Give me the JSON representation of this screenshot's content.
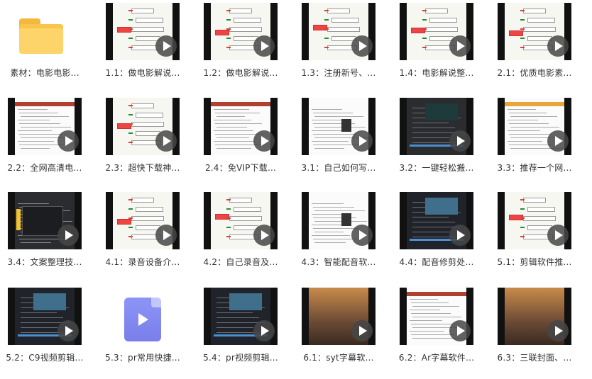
{
  "items": [
    {
      "label": "素材：电影电影...",
      "type": "folder"
    },
    {
      "label": "1.1：做电影解说...",
      "type": "video",
      "style": "mind"
    },
    {
      "label": "1.2：做电影解说...",
      "type": "video",
      "style": "mind"
    },
    {
      "label": "1.3：注册新号、...",
      "type": "video",
      "style": "mind"
    },
    {
      "label": "1.4：电影解说整...",
      "type": "video",
      "style": "mind"
    },
    {
      "label": "2.1：优质电影素...",
      "type": "video",
      "style": "mind"
    },
    {
      "label": "2.2：全网高清电...",
      "type": "video",
      "style": "web"
    },
    {
      "label": "2.3：超快下载神...",
      "type": "video",
      "style": "mind"
    },
    {
      "label": "2.4：免VIP下载...",
      "type": "video",
      "style": "web"
    },
    {
      "label": "3.1：自己如何写...",
      "type": "video",
      "style": "doc"
    },
    {
      "label": "3.2：一键轻松搬...",
      "type": "video",
      "style": "dark"
    },
    {
      "label": "3.3：推荐一个网...",
      "type": "video",
      "style": "web"
    },
    {
      "label": "3.4：文案整理技...",
      "type": "video",
      "style": "app"
    },
    {
      "label": "4.1：录音设备介...",
      "type": "video",
      "style": "mind"
    },
    {
      "label": "4.2：自己录音及...",
      "type": "video",
      "style": "mind"
    },
    {
      "label": "4.3：智能配音软...",
      "type": "video",
      "style": "doc"
    },
    {
      "label": "4.4：配音修剪处...",
      "type": "video",
      "style": "editor"
    },
    {
      "label": "5.1：剪辑软件推...",
      "type": "video",
      "style": "mind"
    },
    {
      "label": "5.2：C9视频剪辑...",
      "type": "video",
      "style": "editor"
    },
    {
      "label": "5.3：pr常用快捷...",
      "type": "doc"
    },
    {
      "label": "5.4：pr视频剪辑...",
      "type": "video",
      "style": "editor"
    },
    {
      "label": "6.1：syt字幕软...",
      "type": "video",
      "style": "film"
    },
    {
      "label": "6.2：Ar字幕软件...",
      "type": "video",
      "style": "web"
    },
    {
      "label": "6.3：三联封面、...",
      "type": "video",
      "style": "film"
    }
  ],
  "icons": {
    "folder": "folder-icon",
    "video": "play-icon",
    "doc": "video-file-icon"
  },
  "colors": {
    "folder": "#f8c44a",
    "doc": "#8088f0",
    "play": "#464646",
    "text": "#333333"
  }
}
